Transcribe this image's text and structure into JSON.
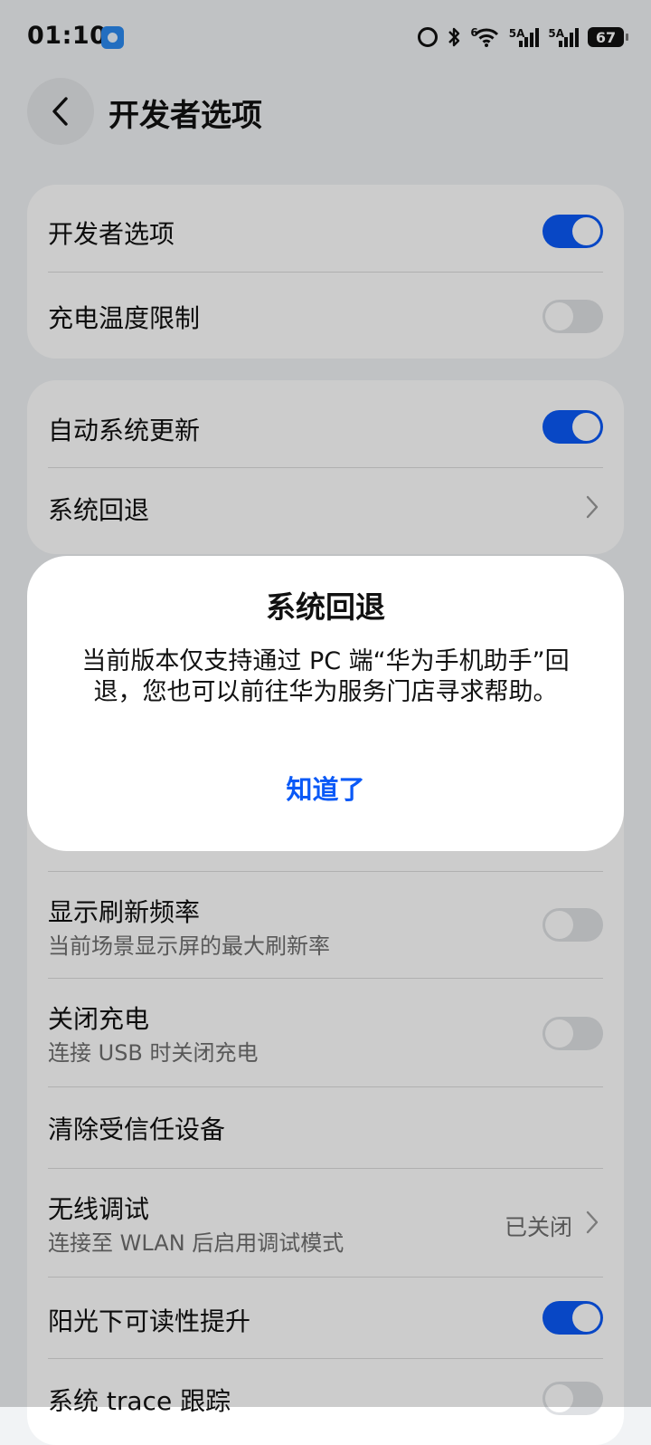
{
  "status_bar": {
    "time": "01:10",
    "signal1_label": "5A",
    "signal2_label": "5A",
    "battery": "67",
    "wifi_label": "6"
  },
  "header": {
    "title": "开发者选项"
  },
  "card1": {
    "items": [
      {
        "label": "开发者选项",
        "toggle": "on"
      },
      {
        "label": "充电温度限制",
        "toggle": "off"
      }
    ]
  },
  "card2": {
    "items": [
      {
        "label": "自动系统更新",
        "toggle": "on"
      },
      {
        "label": "系统回退"
      }
    ]
  },
  "list": {
    "items": [
      {
        "label": "显示刷新频率",
        "sub": "当前场景显示屏的最大刷新率",
        "toggle": "off"
      },
      {
        "label": "关闭充电",
        "sub": "连接 USB 时关闭充电",
        "toggle": "off"
      },
      {
        "label": "清除受信任设备"
      },
      {
        "label": "无线调试",
        "sub": "连接至 WLAN 后启用调试模式",
        "value": "已关闭"
      },
      {
        "label": "阳光下可读性提升",
        "toggle": "on"
      },
      {
        "label": "系统 trace 跟踪",
        "toggle": "off"
      }
    ]
  },
  "dialog": {
    "title": "系统回退",
    "message": "当前版本仅支持通过 PC 端“华为手机助手”回退，您也可以前往华为服务门店寻求帮助。",
    "button": "知道了"
  },
  "colors": {
    "accent": "#0a59f7",
    "background": "#f1f3f5",
    "card": "#ffffff"
  },
  "icons": [
    "back-arrow-icon",
    "chevron-right-icon",
    "alarm-icon",
    "bluetooth-icon",
    "wifi-icon",
    "signal-icon",
    "battery-icon"
  ]
}
